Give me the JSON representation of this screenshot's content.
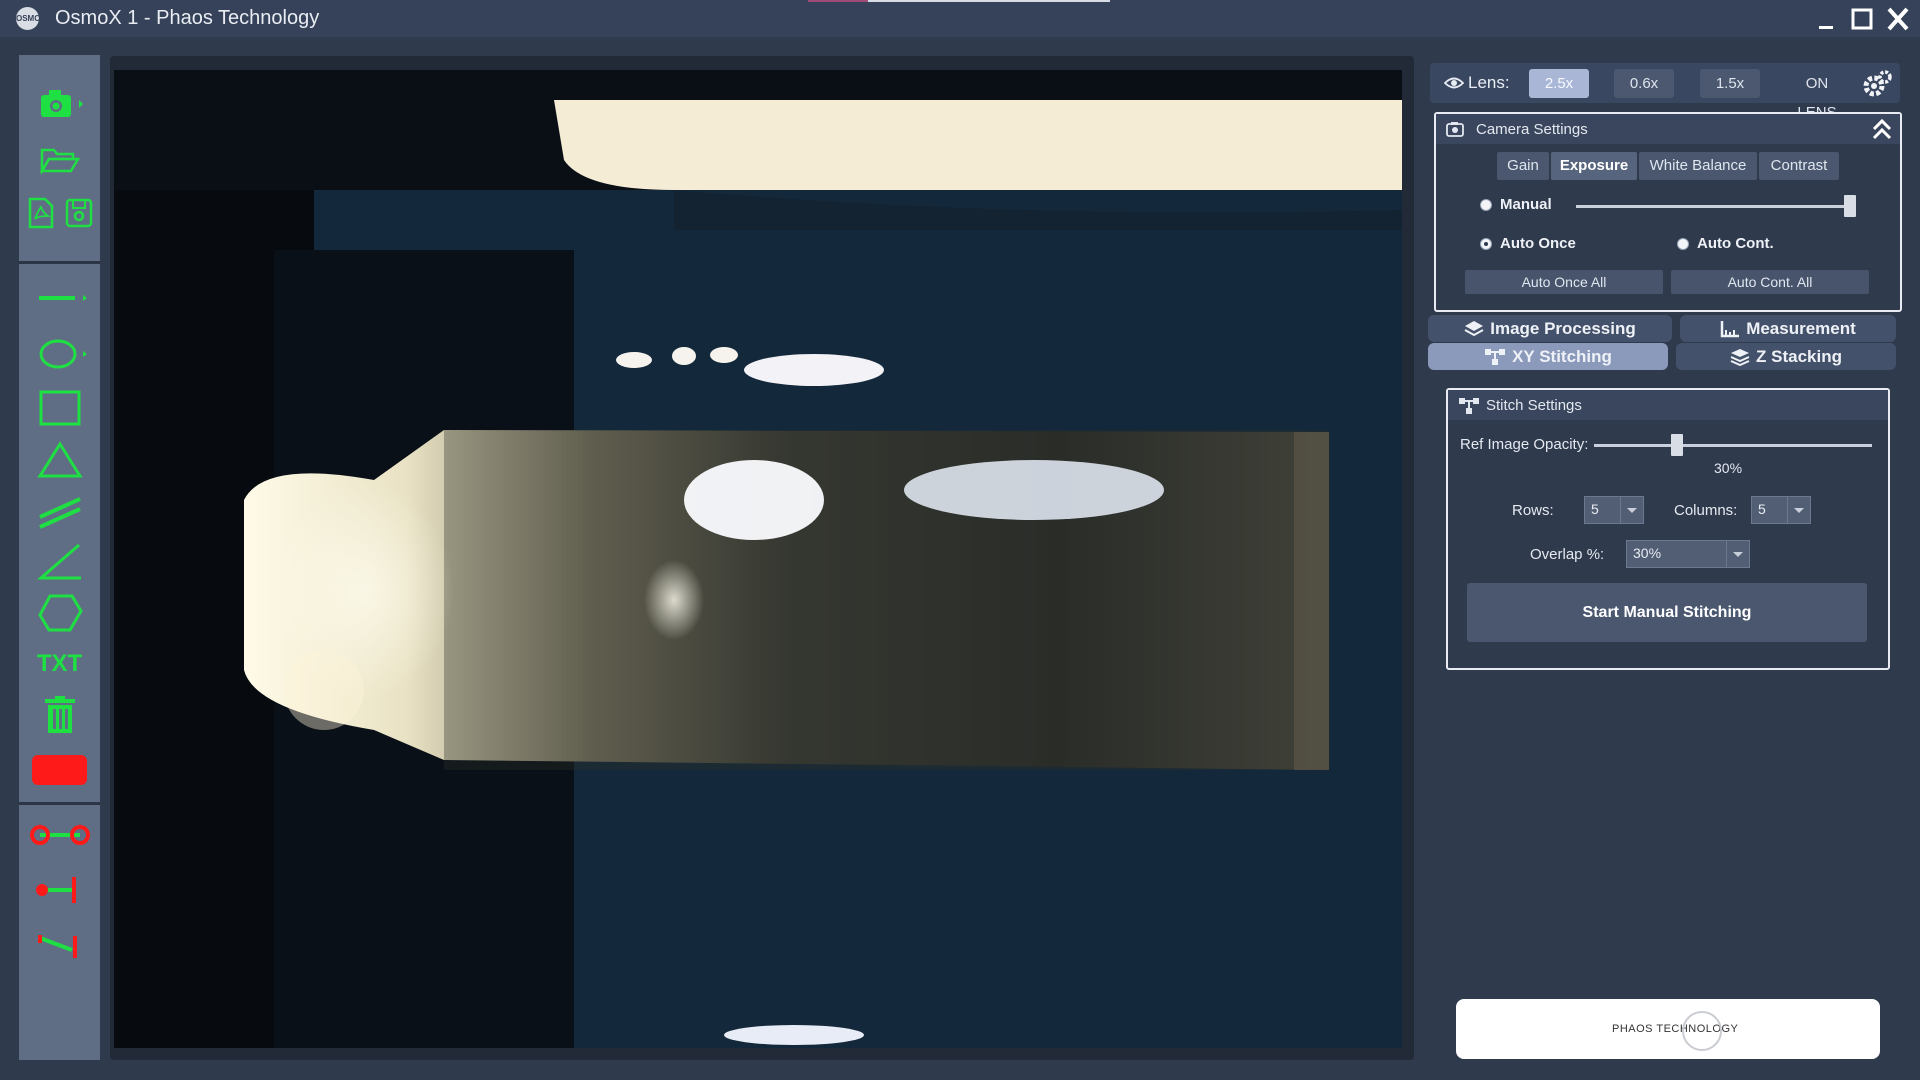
{
  "window": {
    "title": "OsmoX 1 - Phaos Technology",
    "logo_text": "OSMO",
    "controls": [
      "minimize",
      "maximize",
      "close"
    ]
  },
  "toolbar": {
    "accent_color": "#1ee043",
    "tools": [
      {
        "name": "camera-icon"
      },
      {
        "name": "open-folder-icon"
      },
      {
        "name": "pdf-icon"
      },
      {
        "name": "save-icon"
      },
      {
        "name": "line-icon"
      },
      {
        "name": "ellipse-icon"
      },
      {
        "name": "rectangle-icon"
      },
      {
        "name": "triangle-icon"
      },
      {
        "name": "parallel-lines-icon"
      },
      {
        "name": "angle-icon"
      },
      {
        "name": "polygon-icon"
      },
      {
        "name": "text-tool",
        "label": "TXT"
      },
      {
        "name": "trash-icon"
      },
      {
        "name": "color-swatch",
        "color": "#ff1a1a"
      },
      {
        "name": "point-distance-icon"
      },
      {
        "name": "point-line-distance-icon"
      },
      {
        "name": "line-line-distance-icon"
      }
    ]
  },
  "lens": {
    "label": "Lens:",
    "options": [
      "2.5x",
      "0.6x",
      "1.5x",
      "ON LENS"
    ],
    "selected": "2.5x"
  },
  "camera_settings": {
    "title": "Camera Settings",
    "tabs": [
      "Gain",
      "Exposure",
      "White Balance",
      "Contrast"
    ],
    "active_tab": "Exposure",
    "manual_label": "Manual",
    "auto_once_label": "Auto Once",
    "auto_cont_label": "Auto Cont.",
    "selected_mode": "Auto Once",
    "exposure_level": 0.98,
    "auto_once_all": "Auto Once All",
    "auto_cont_all": "Auto Cont. All"
  },
  "modes": {
    "image_processing": "Image Processing",
    "measurement": "Measurement",
    "xy_stitching": "XY Stitching",
    "z_stacking": "Z Stacking",
    "active": "XY Stitching"
  },
  "stitch_settings": {
    "title": "Stitch Settings",
    "opacity_label": "Ref Image Opacity:",
    "opacity_value": "30%",
    "opacity_fraction": 0.3,
    "rows_label": "Rows:",
    "rows_value": "5",
    "columns_label": "Columns:",
    "columns_value": "5",
    "overlap_label": "Overlap %:",
    "overlap_value": "30%",
    "start_button": "Start Manual Stitching"
  },
  "footer_logo": {
    "text": "PHAOS TECHNOLOGY"
  }
}
